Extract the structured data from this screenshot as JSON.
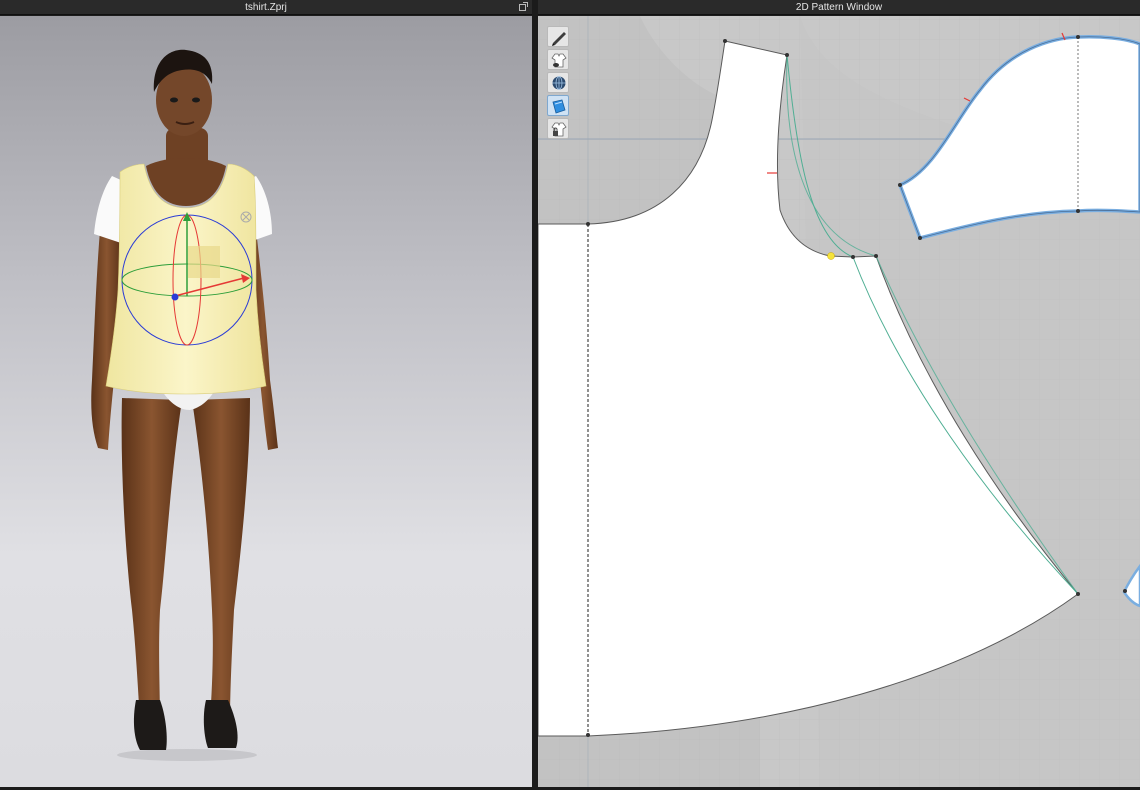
{
  "windows": {
    "view3d": {
      "title": "tshirt.Zprj",
      "popout_icon": "popout-icon"
    },
    "view2d": {
      "title": "2D Pattern Window"
    }
  },
  "toolbar": {
    "tools": [
      {
        "icon": "pen-icon"
      },
      {
        "icon": "garment-view-icon"
      },
      {
        "icon": "globe-icon"
      },
      {
        "icon": "fabric-icon"
      },
      {
        "icon": "garment-lock-icon"
      }
    ]
  },
  "colors": {
    "garment": "#f5eeb0",
    "skin": "#7a4a2a",
    "pattern_fill": "#ffffff",
    "pattern_selected_outline": "#7aaee0",
    "seam_line": "#4fae93",
    "gizmo_x": "#e53935",
    "gizmo_y": "#2e9e3a",
    "gizmo_z": "#2a3bd6"
  }
}
